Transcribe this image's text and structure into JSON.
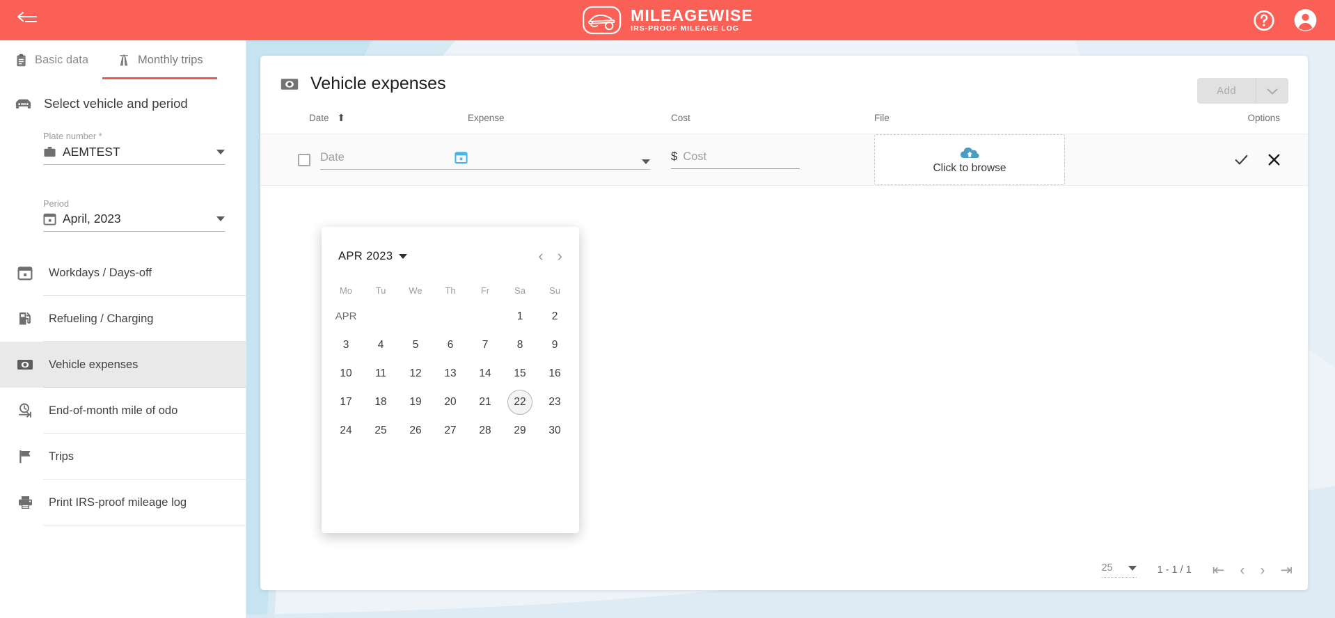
{
  "topbar": {
    "collapse_icon": "collapse-arrow-icon",
    "brand_title": "MILEAGEWISE",
    "brand_subtitle": "IRS-PROOF MILEAGE LOG",
    "help_icon": "help-circle-icon",
    "account_icon": "account-circle-icon",
    "background_color": "#fb6056"
  },
  "tabs": [
    {
      "label": "Basic data",
      "icon": "clipboard-icon",
      "active": false
    },
    {
      "label": "Monthly trips",
      "icon": "highway-icon",
      "active": true
    }
  ],
  "vehicle_selector": {
    "icon": "car-icon",
    "title": "Select vehicle and period",
    "fields": [
      {
        "label": "Plate number *",
        "value": "AEMTEST",
        "icon": "briefcase-icon"
      },
      {
        "label": "Period",
        "value": "April, 2023",
        "icon": "calendar-icon"
      }
    ]
  },
  "menu": {
    "items": [
      {
        "label": "Workdays / Days-off",
        "icon": "calendar-icon",
        "active": false
      },
      {
        "label": "Refueling / Charging",
        "icon": "fuel-pump-icon",
        "active": false
      },
      {
        "label": "Vehicle expenses",
        "icon": "money-icon",
        "active": true
      },
      {
        "label": "End-of-month mile of odo",
        "icon": "odometer-icon",
        "active": false
      },
      {
        "label": "Trips",
        "icon": "flag-icon",
        "active": false
      },
      {
        "label": "Print IRS-proof mileage log",
        "icon": "printer-icon",
        "active": false
      }
    ]
  },
  "card": {
    "title": "Vehicle expenses",
    "title_icon": "money-icon",
    "add_label": "Add",
    "add_caret_icon": "chevron-down-icon",
    "add_disabled": true,
    "columns": [
      {
        "key": "date",
        "label": "Date",
        "sorted": "asc",
        "sort_icon": "arrow-up-icon"
      },
      {
        "key": "expense",
        "label": "Expense"
      },
      {
        "key": "cost",
        "label": "Cost"
      },
      {
        "key": "file",
        "label": "File"
      },
      {
        "key": "options",
        "label": "Options"
      }
    ],
    "edit_row": {
      "checkbox_checked": false,
      "date_placeholder": "Date",
      "date_value": "",
      "date_picker_icon": "calendar-picker-icon",
      "expense_value": "",
      "expense_caret_icon": "chevron-down-icon",
      "cost_symbol": "$",
      "cost_placeholder": "Cost",
      "cost_value": "",
      "file_upload_label": "Click to browse",
      "file_upload_icon": "cloud-upload-icon",
      "confirm_icon": "check-icon",
      "cancel_icon": "close-icon"
    }
  },
  "datepicker": {
    "open": true,
    "header_label": "APR 2023",
    "header_caret_icon": "caret-down-icon",
    "prev_icon": "chevron-left-icon",
    "next_icon": "chevron-right-icon",
    "weekdays": [
      "Mo",
      "Tu",
      "We",
      "Th",
      "Fr",
      "Sa",
      "Su"
    ],
    "month_label": "APR",
    "today": 22,
    "weeks": [
      [
        "APR",
        "",
        "",
        "",
        "",
        "1",
        "2"
      ],
      [
        "3",
        "4",
        "5",
        "6",
        "7",
        "8",
        "9"
      ],
      [
        "10",
        "11",
        "12",
        "13",
        "14",
        "15",
        "16"
      ],
      [
        "17",
        "18",
        "19",
        "20",
        "21",
        "22",
        "23"
      ],
      [
        "24",
        "25",
        "26",
        "27",
        "28",
        "29",
        "30"
      ]
    ]
  },
  "pagination": {
    "page_size": "25",
    "page_size_caret_icon": "caret-down-icon",
    "range_label": "1 - 1 / 1",
    "first_icon": "first-page-icon",
    "prev_icon": "prev-page-icon",
    "next_icon": "next-page-icon",
    "last_icon": "last-page-icon"
  },
  "colors": {
    "brand_red": "#fb6056",
    "tab_underline": "#f1584c",
    "accent_blue": "#4ab3e8",
    "upload_blue": "#4a9cc0",
    "stage_bg": "#eef3f8"
  }
}
